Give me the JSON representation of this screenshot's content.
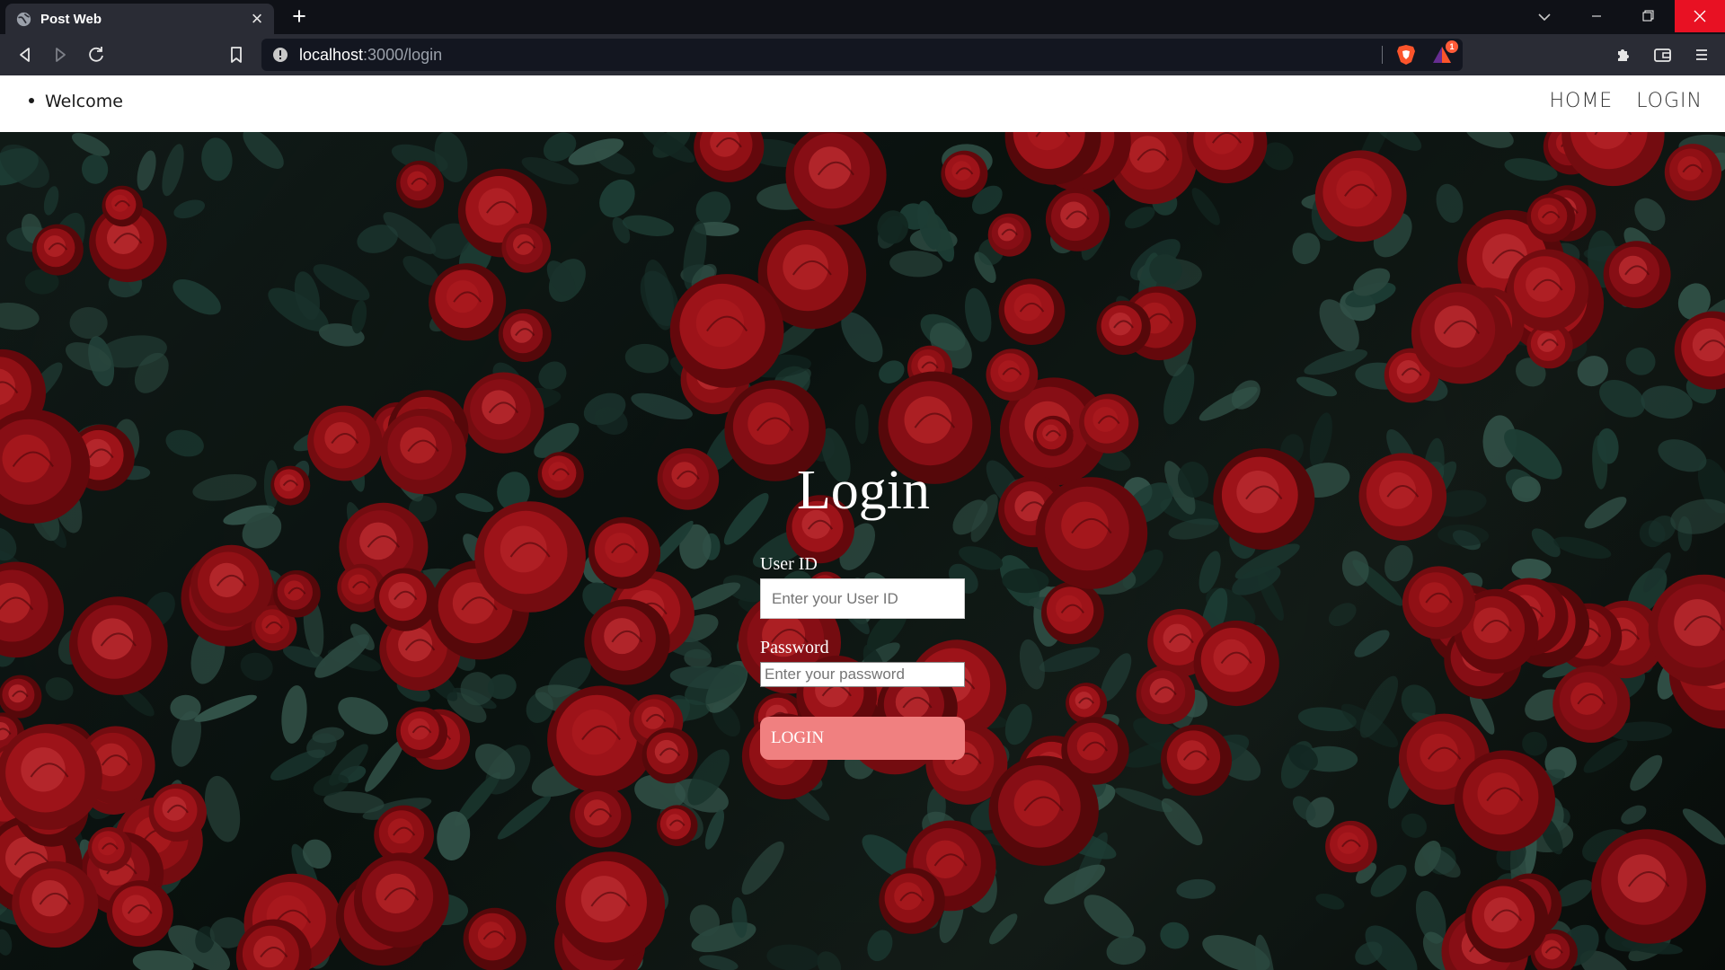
{
  "browser": {
    "tab_title": "Post Web",
    "tab_close": "×",
    "new_tab": "+",
    "url_host": "localhost",
    "url_rest": ":3000/login",
    "rewards_badge": "1"
  },
  "navbar": {
    "welcome": "Welcome",
    "links": [
      "HOME",
      "LOGIN"
    ]
  },
  "login": {
    "title": "Login",
    "user_label": "User ID",
    "user_placeholder": "Enter your User ID",
    "password_label": "Password",
    "password_placeholder": "Enter your password",
    "button": "LOGIN"
  },
  "colors": {
    "button": "#f08080",
    "close_button": "#e81123",
    "chrome_dark": "#0f1117",
    "chrome_toolbar": "#2a2c35"
  },
  "icons": [
    "globe-icon",
    "close-icon",
    "plus-icon",
    "chevron-down-icon",
    "minimize-icon",
    "restore-icon",
    "back-icon",
    "forward-icon",
    "reload-icon",
    "bookmark-icon",
    "info-icon",
    "brave-shield-icon",
    "brave-rewards-icon",
    "puzzle-icon",
    "wallet-icon",
    "hamburger-menu-icon"
  ]
}
